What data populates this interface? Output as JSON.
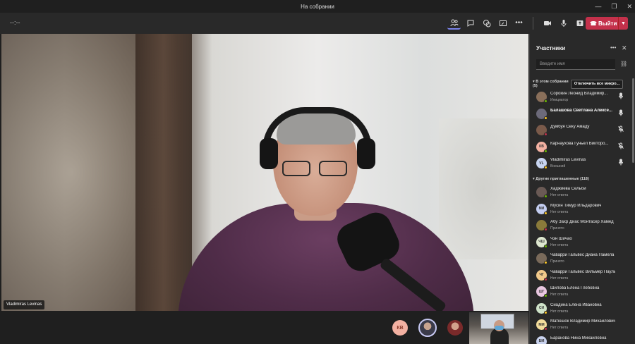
{
  "window": {
    "title": "На собрании",
    "controls": [
      "—",
      "❐",
      "✕"
    ]
  },
  "toolbar": {
    "timer": "--:--",
    "leave_label": "Выйти"
  },
  "video": {
    "speaker_name": "Vladimiras Levinas"
  },
  "bottom_strip": {
    "avatars": [
      {
        "initials": "КВ"
      }
    ]
  },
  "panel": {
    "title": "Участники",
    "search_placeholder": "Введите имя",
    "in_meeting_header": "В этом собрании (5)",
    "mute_all_label": "Отключить все микро...",
    "in_meeting": [
      {
        "name": "Сорокин Леонид Владимир...",
        "status": "Инициатор",
        "initials": "",
        "color": "#8a6f5a",
        "mic": "on"
      },
      {
        "name": "Балашова Светлана Алексе...",
        "status": "",
        "initials": "",
        "color": "#6c6a7a",
        "mic": "on",
        "bold": true
      },
      {
        "name": "Думбуя Секу Амаду",
        "status": "",
        "initials": "",
        "color": "#7a5a4a",
        "mic": "off"
      },
      {
        "name": "Карнаухова Гуньел Викторо...",
        "status": "",
        "initials": "КВ",
        "color": "#f3b1a2",
        "mic": "off"
      },
      {
        "name": "Vladimiras Levinas",
        "status": "Внешний",
        "initials": "VL",
        "color": "#c7d4f0",
        "mic": "on"
      }
    ],
    "others_header": "Другие приглашенные (118)",
    "others": [
      {
        "name": "Хаджиева Сельби",
        "status": "Нет ответа",
        "initials": "",
        "color": "#6a5a55"
      },
      {
        "name": "Мусин Тимур Ильдарович",
        "status": "Нет ответа",
        "initials": "МИ",
        "color": "#c3cdf0"
      },
      {
        "name": "Абу Захр Диас Монтасер Хамед",
        "status": "Принято",
        "initials": "",
        "color": "#8a7a3a"
      },
      {
        "name": "Чэн Шичао",
        "status": "Нет ответа",
        "initials": "ЧШ",
        "color": "#dfe8d0"
      },
      {
        "name": "Чаварри Гальвес Диана Памела",
        "status": "Принято",
        "initials": "",
        "color": "#7a6a5a"
      },
      {
        "name": "Чаварри Гальвес Вильмер Пауль",
        "status": "Нет ответа",
        "initials": "ЧГ",
        "color": "#f2c98a"
      },
      {
        "name": "Шилова Елена Глебовна",
        "status": "Нет ответа",
        "initials": "ШГ",
        "color": "#e9c7e0"
      },
      {
        "name": "Сиадина Елена Ивановна",
        "status": "Нет ответа",
        "initials": "СИ",
        "color": "#cfe3c9"
      },
      {
        "name": "Матюшок Владимир Михайлович",
        "status": "Нет ответа",
        "initials": "ММ",
        "color": "#f3dc9b"
      },
      {
        "name": "Баранова Нина Михайловна",
        "status": "",
        "initials": "БМ",
        "color": "#c9d2ee"
      }
    ],
    "colors": {
      "available": "#6bb700",
      "away": "#fcc624",
      "busy": "#c4314b",
      "unknown": "#8a8a8a"
    }
  }
}
